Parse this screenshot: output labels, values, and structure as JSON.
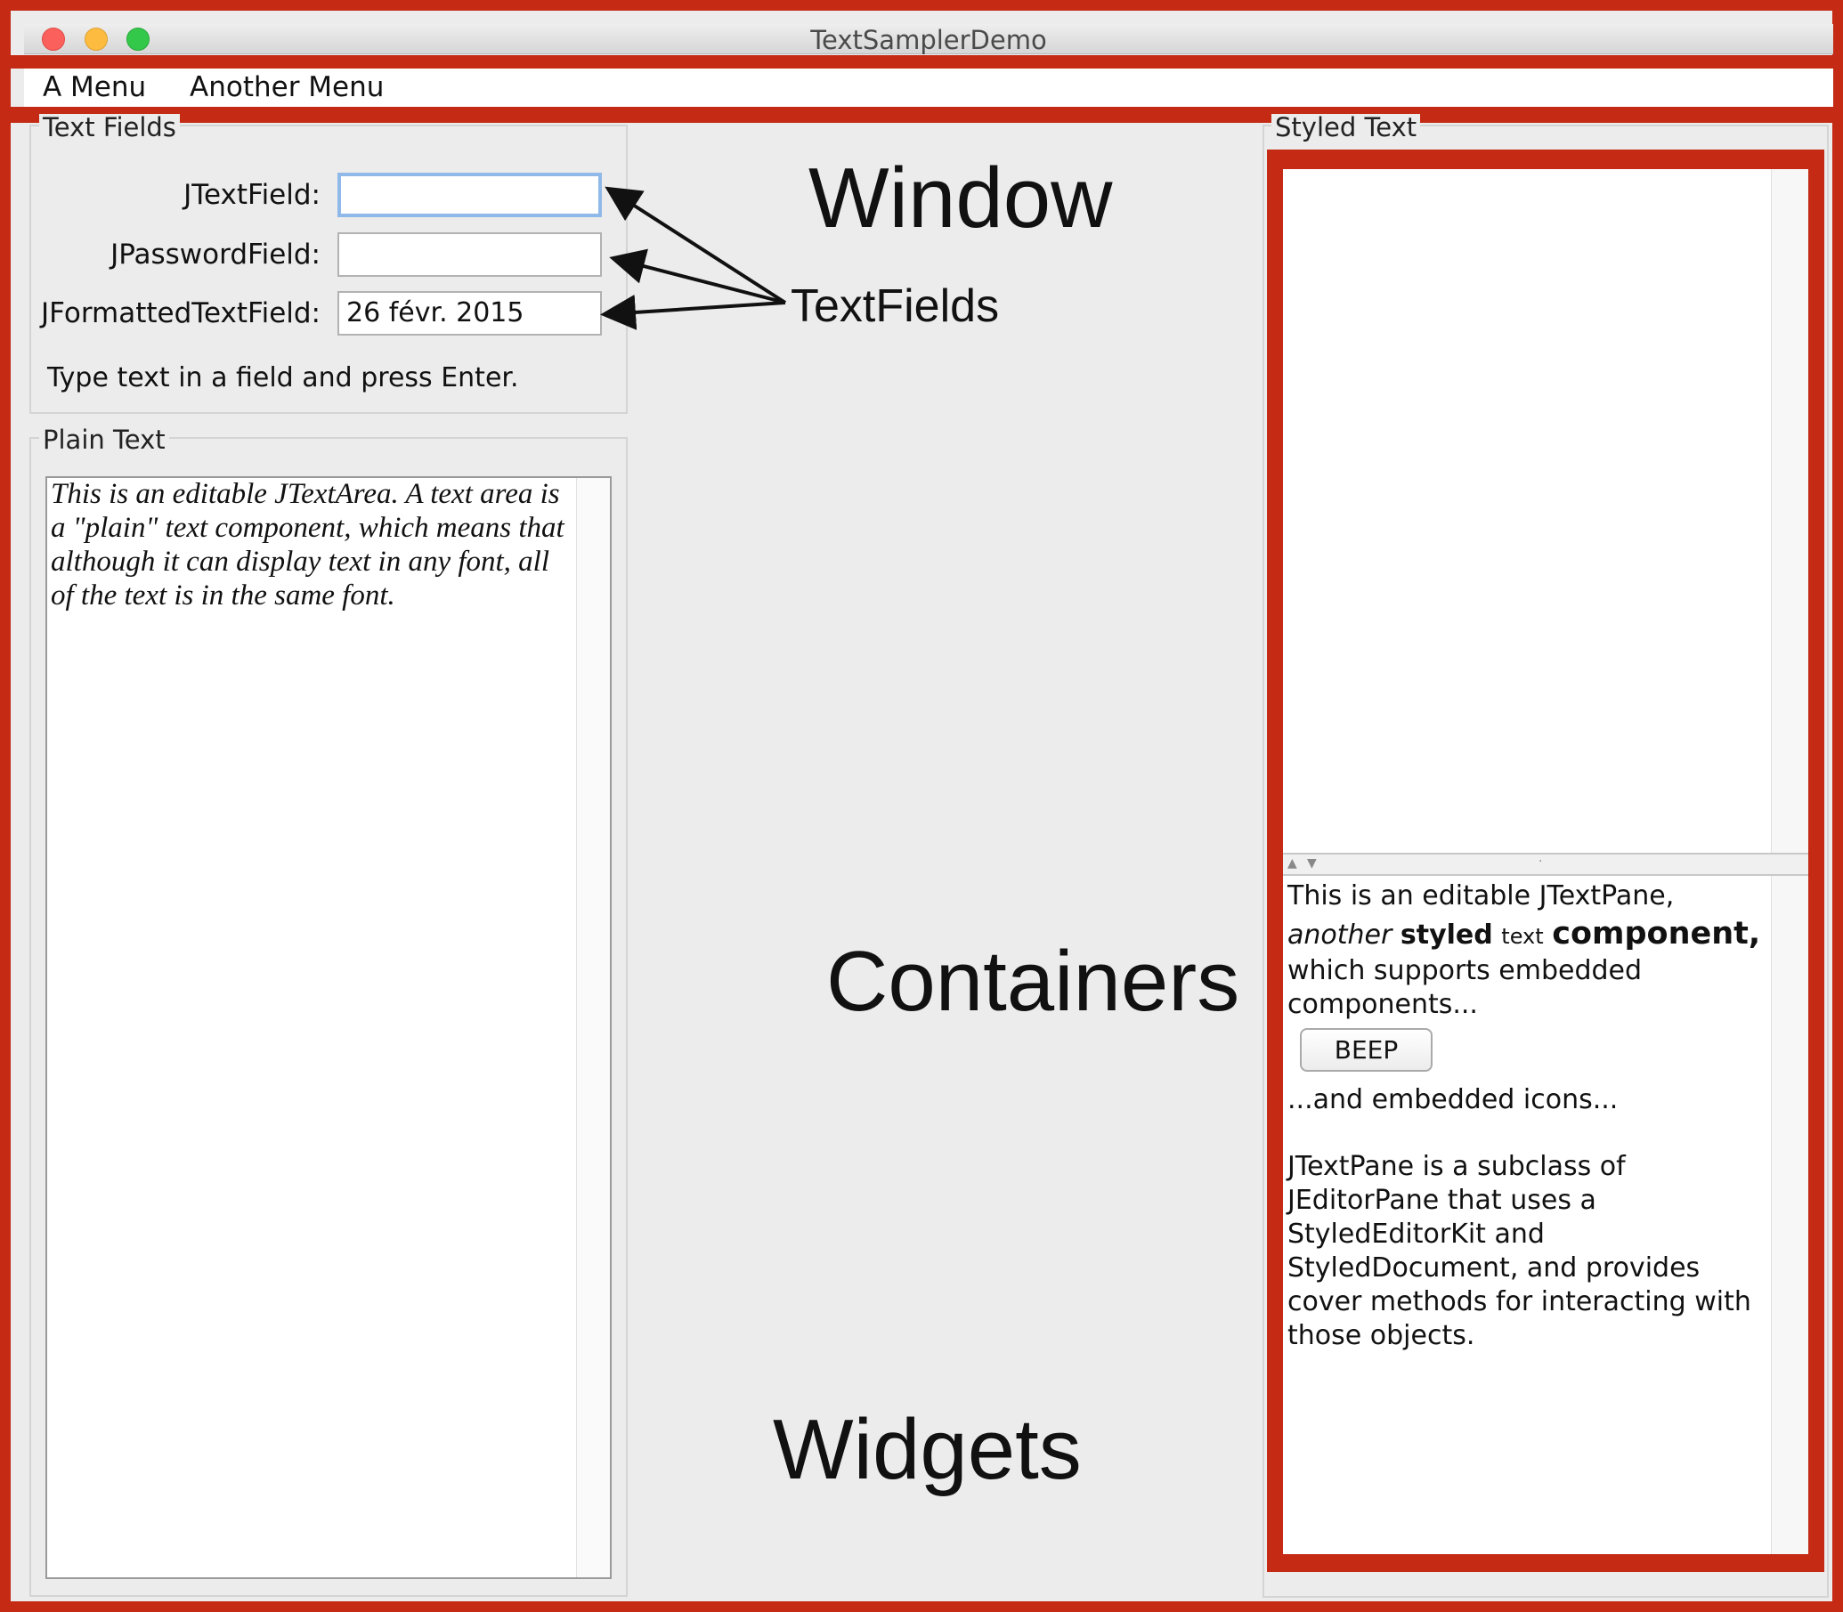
{
  "window": {
    "title": "TextSamplerDemo"
  },
  "menubar": {
    "items": [
      "A Menu",
      "Another Menu"
    ]
  },
  "text_fields": {
    "legend": "Text Fields",
    "textfield_label": "JTextField:",
    "textfield_value": "",
    "password_label": "JPasswordField:",
    "password_value": "",
    "formatted_label": "JFormattedTextField:",
    "formatted_value": "26 févr. 2015",
    "hint": "Type text in a field and press Enter."
  },
  "plain_text": {
    "legend": "Plain Text",
    "content": "This is an editable JTextArea. A text area is a \"plain\" text component, which means that although it can display text in any font, all of the text is in the same font."
  },
  "styled_text": {
    "legend": "Styled Text",
    "line1": "This is an editable JTextPane,",
    "line2_a": "another",
    "line2_b": "styled",
    "line2_c": "text",
    "line2_d": "component,",
    "line3": "which supports embedded",
    "line4": "components...",
    "beep_label": "BEEP",
    "line5": "...and embedded icons...",
    "paragraph2": "JTextPane is a subclass of JEditorPane that uses a StyledEditorKit and StyledDocument, and provides cover methods for interacting with those objects."
  },
  "annotations": {
    "window": "Window",
    "textfields": "TextFields",
    "containers": "Containers",
    "widgets": "Widgets"
  },
  "colors": {
    "highlight_red": "#c42a14",
    "window_background": "#ececec",
    "focus_ring": "#8fb9e8"
  },
  "icons": [
    "close-traffic-light",
    "minimize-traffic-light",
    "maximize-traffic-light",
    "split-up-arrow",
    "split-down-arrow"
  ]
}
